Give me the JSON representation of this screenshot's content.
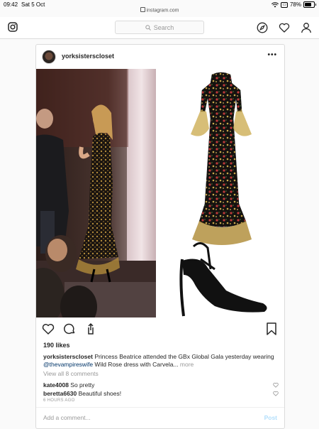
{
  "status": {
    "time": "09:42",
    "date": "Sat 5 Oct",
    "url": "instagram.com",
    "battery_pct": "78%",
    "battery_level": 0.78
  },
  "nav": {
    "search_placeholder": "Search"
  },
  "post": {
    "username": "yorksisterscloset",
    "likes": "190 likes",
    "caption": {
      "username": "yorksisterscloset",
      "text1": "Princess Beatrice attended the GBx Global Gala yesterday wearing",
      "mention": "@thevampireswife",
      "text2": "Wild Rose dress with Carvela...",
      "more": "more"
    },
    "view_all": "View all 8 comments",
    "comments": [
      {
        "user": "kate4008",
        "text": "So pretty"
      },
      {
        "user": "beretta6630",
        "text": "Beautiful shoes!"
      }
    ],
    "timestamp": "6 HOURS AGO",
    "add_comment_placeholder": "Add a comment...",
    "post_label": "Post"
  },
  "colors": {
    "accent": "#3897f0",
    "post_disabled": "#b2dffc",
    "border": "#dbdbdb",
    "mention": "#003569"
  }
}
